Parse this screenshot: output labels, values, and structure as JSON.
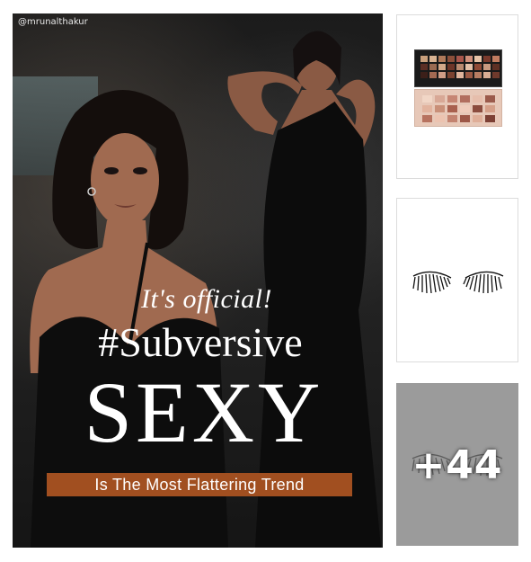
{
  "hero": {
    "handle": "@mrunalthakur",
    "headline_line1": "It's official!",
    "headline_line2": "#Subversive",
    "headline_line3": "SEXY",
    "banner": "Is The Most Flattering Trend",
    "banner_color": "#a14f20"
  },
  "thumbnails": [
    {
      "name": "eyeshadow-palette",
      "icon": "eyeshadow-palette-icon"
    },
    {
      "name": "false-eyelashes",
      "icon": "eyelashes-icon"
    },
    {
      "name": "more-items",
      "label": "+44",
      "bg_color": "#9b9b9b"
    }
  ]
}
